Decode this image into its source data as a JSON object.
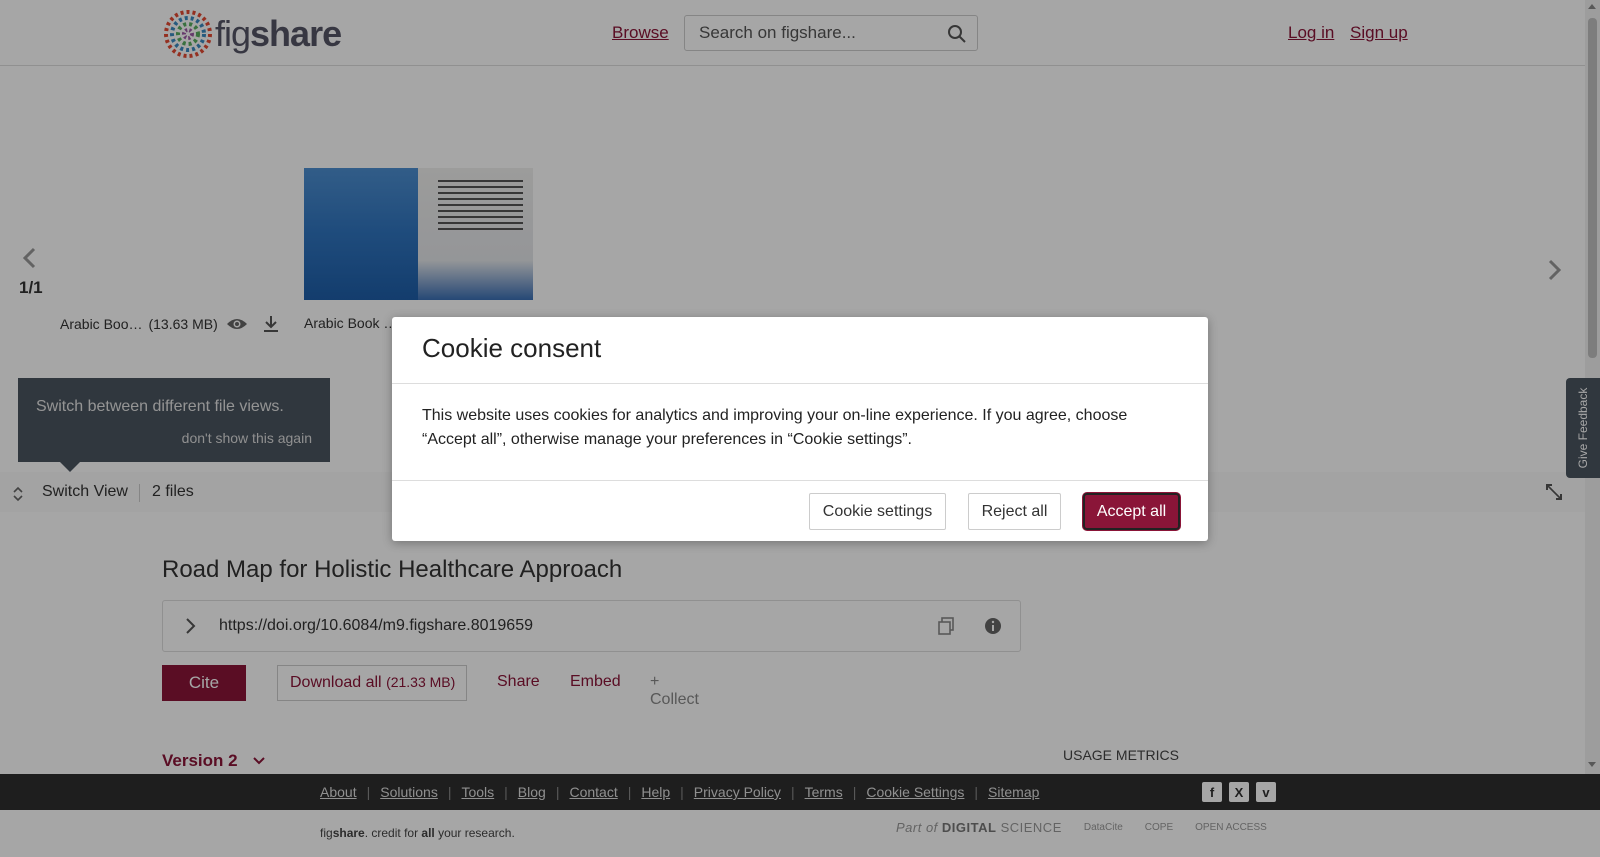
{
  "header": {
    "logo_text_fig": "fig",
    "logo_text_share": "share",
    "browse": "Browse",
    "search_placeholder": "Search on figshare...",
    "login": "Log in",
    "signup": "Sign up"
  },
  "viewer": {
    "pager": "1/1",
    "files": [
      {
        "name": "Arabic Boo…",
        "size": "(13.63 MB)"
      },
      {
        "name": "Arabic Book …"
      }
    ],
    "tip": {
      "message": "Switch between different file views.",
      "dismiss": "don't show this again"
    },
    "switch_view": "Switch View",
    "file_count": "2 files"
  },
  "item": {
    "title": "Road Map for Holistic Healthcare Approach",
    "doi": "https://doi.org/10.6084/m9.figshare.8019659",
    "cite": "Cite",
    "download_label": "Download all",
    "download_size": "(21.33 MB)",
    "share": "Share",
    "embed": "Embed",
    "collect": "+ Collect",
    "version": "Version 2",
    "usage_metrics": "USAGE METRICS"
  },
  "footer": {
    "links": [
      "About",
      "Solutions",
      "Tools",
      "Blog",
      "Contact",
      "Help",
      "Privacy Policy",
      "Terms",
      "Cookie Settings",
      "Sitemap"
    ],
    "social": [
      "f",
      "X",
      "v"
    ],
    "credit_pre": "fig",
    "credit_bold": "share",
    "credit_mid": ". credit for ",
    "credit_all": "all",
    "credit_post": " your research.",
    "partners": [
      "Part of",
      "DIGITAL",
      "SCIENCE",
      "DataCite",
      "COPE",
      "OPEN ACCESS"
    ]
  },
  "feedback": "Give Feedback",
  "cookie": {
    "title": "Cookie consent",
    "text": "This website uses cookies for analytics and improving your on-line experience. If you agree, choose “Accept all”, otherwise manage your preferences in “Cookie settings”.",
    "settings": "Cookie settings",
    "reject": "Reject all",
    "accept": "Accept all"
  },
  "colors": {
    "brand": "#8a1538",
    "footer_bg": "#2f2f2f",
    "tip_bg": "#4a5560"
  }
}
